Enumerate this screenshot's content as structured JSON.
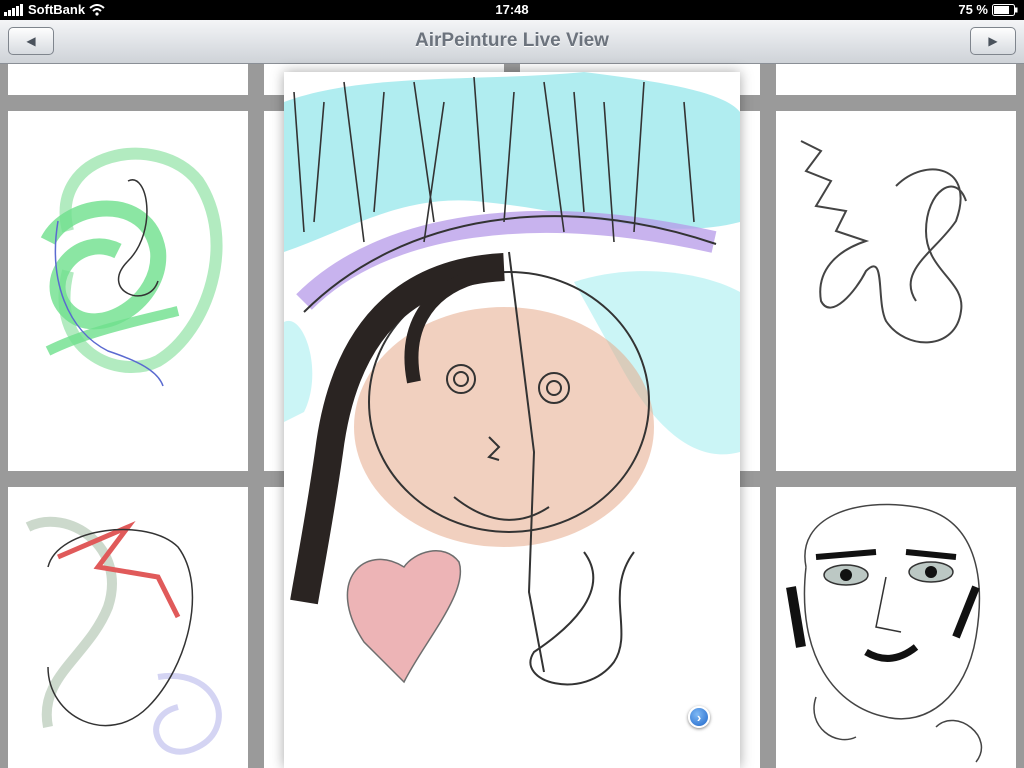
{
  "status_bar": {
    "carrier": "SoftBank",
    "time": "17:48",
    "battery": "75 %",
    "icons": [
      "signal-bars-icon",
      "wifi-icon",
      "battery-icon"
    ]
  },
  "nav": {
    "title": "AirPeinture Live View",
    "prev_icon": "◀",
    "next_icon": "▶"
  },
  "detail": {
    "info_icon": "›"
  },
  "colors": {
    "accent": "#1f66c9",
    "background": "#9a9a9a",
    "nav_title": "#6c737d"
  }
}
